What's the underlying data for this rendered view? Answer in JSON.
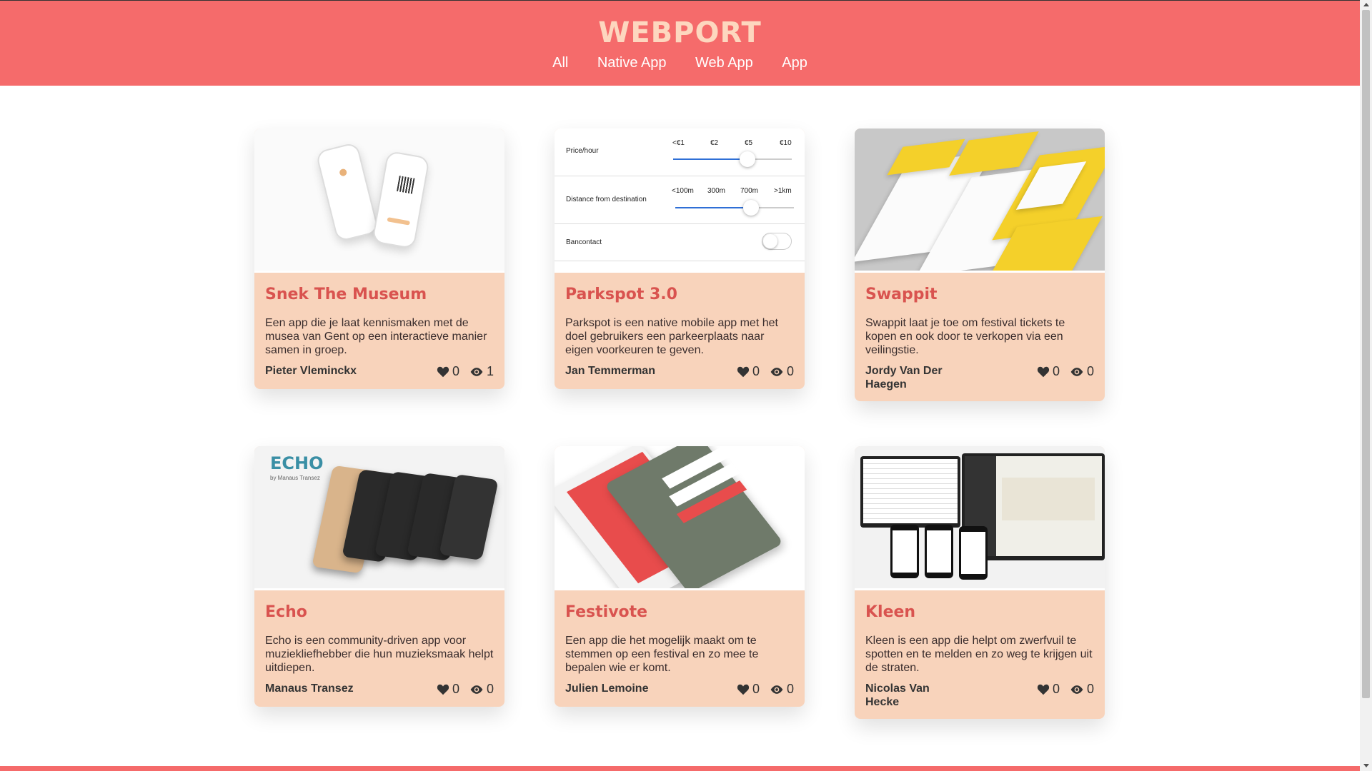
{
  "header": {
    "brand": "WEBPORT",
    "nav": [
      "All",
      "Native App",
      "Web App",
      "App"
    ],
    "colors": {
      "header_bg": "#f56b6b",
      "brand": "#fdd7bf",
      "card_bg": "#f8d3bb",
      "title": "#d9534f"
    }
  },
  "parkspot_thumb": {
    "row1_label": "Price/hour",
    "row1_ticks": [
      "<€1",
      "€2",
      "€5",
      "€10"
    ],
    "row2_label": "Distance from destination",
    "row2_ticks": [
      "<100m",
      "300m",
      "700m",
      ">1km"
    ],
    "row3_label": "Bancontact"
  },
  "echo_thumb": {
    "logo": "ECHO",
    "sub": "by Manaus Transez"
  },
  "cards": [
    {
      "title": "Snek The Museum",
      "desc": "Een app die je laat kennismaken met de musea van Gent op een interactieve manier samen in groep.",
      "author": "Pieter Vleminckx",
      "likes": "0",
      "views": "1"
    },
    {
      "title": "Parkspot 3.0",
      "desc": "Parkspot is een native mobile app met het doel gebruikers een parkeerplaats naar eigen voorkeuren te geven.",
      "author": "Jan Temmerman",
      "likes": "0",
      "views": "0"
    },
    {
      "title": "Swappit",
      "desc": "Swappit laat je toe om festival tickets te kopen en ook door te verkopen via een veilingstie.",
      "author": "Jordy Van Der Haegen",
      "likes": "0",
      "views": "0"
    },
    {
      "title": "Echo",
      "desc": "Echo is een community-driven app voor muziekliefhebber die hun muzieksmaak helpt uitdiepen.",
      "author": "Manaus Transez",
      "likes": "0",
      "views": "0"
    },
    {
      "title": "Festivote",
      "desc": "Een app die het mogelijk maakt om te stemmen op een festival en zo mee te bepalen wie er komt.",
      "author": "Julien Lemoine",
      "likes": "0",
      "views": "0"
    },
    {
      "title": "Kleen",
      "desc": "Kleen is een app die helpt om zwerfvuil te spotten en te melden en zo weg te krijgen uit de straten.",
      "author": "Nicolas Van Hecke",
      "likes": "0",
      "views": "0"
    }
  ]
}
